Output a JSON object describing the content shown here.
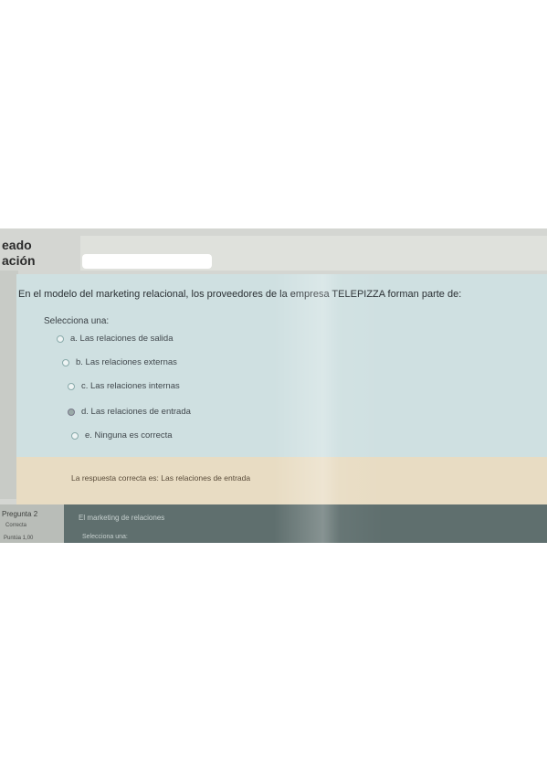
{
  "header": {
    "left_top": "eado",
    "left_bottom": "ación"
  },
  "question": {
    "text": "En el modelo del marketing relacional, los proveedores de la empresa TELEPIZZA forman parte de:",
    "prompt": "Selecciona una:",
    "options": [
      {
        "label": "a. Las relaciones de salida",
        "selected": false
      },
      {
        "label": "b. Las relaciones externas",
        "selected": false
      },
      {
        "label": "c. Las relaciones internas",
        "selected": false
      },
      {
        "label": "d. Las relaciones de entrada",
        "selected": true
      },
      {
        "label": "e. Ninguna es correcta",
        "selected": false
      }
    ],
    "feedback": "La respuesta correcta es: Las relaciones de entrada"
  },
  "question2": {
    "label": "Pregunta 2",
    "state": "Correcta",
    "points": "Puntúa 1,00",
    "text": "El marketing de relaciones",
    "prompt": "Selecciona una:"
  }
}
